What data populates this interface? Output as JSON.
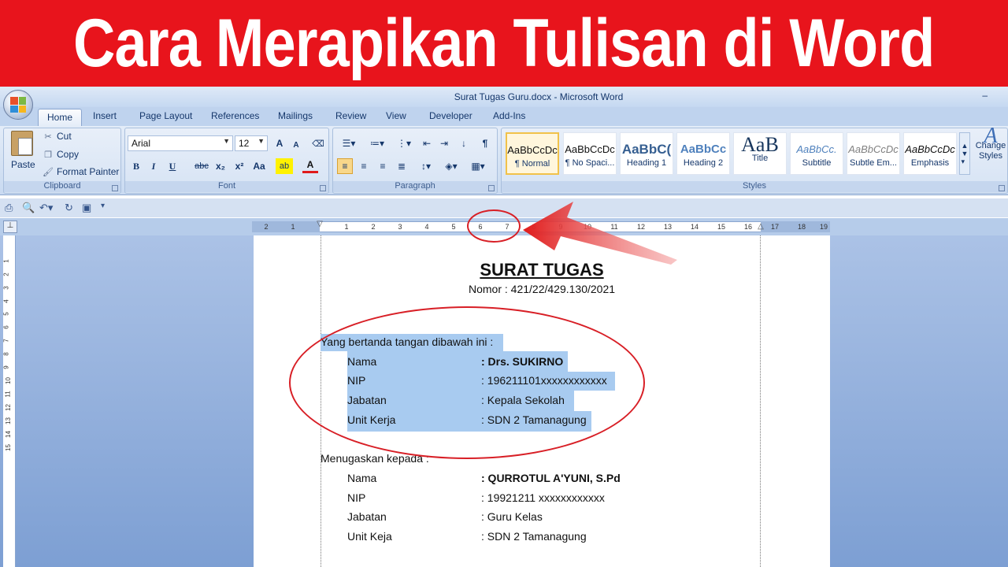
{
  "banner": {
    "title": "Cara Merapikan Tulisan di Word"
  },
  "window": {
    "title": "Surat Tugas Guru.docx - Microsoft Word",
    "minimize": "–"
  },
  "tabs": [
    "Home",
    "Insert",
    "Page Layout",
    "References",
    "Mailings",
    "Review",
    "View",
    "Developer",
    "Add-Ins"
  ],
  "clipboard": {
    "paste": "Paste",
    "cut": "Cut",
    "copy": "Copy",
    "format_painter": "Format Painter",
    "label": "Clipboard"
  },
  "font": {
    "name": "Arial",
    "size": "12",
    "label": "Font",
    "grow": "A",
    "shrink": "A",
    "bold": "B",
    "italic": "I",
    "underline": "U",
    "strike": "abc",
    "sub": "x₂",
    "sup": "x²",
    "case": "Aa"
  },
  "paragraph": {
    "label": "Paragraph",
    "pilcrow": "¶"
  },
  "styles": {
    "label": "Styles",
    "items": [
      {
        "sample": "AaBbCcDc",
        "name": "¶ Normal"
      },
      {
        "sample": "AaBbCcDc",
        "name": "¶ No Spaci..."
      },
      {
        "sample": "AaBbC(",
        "name": "Heading 1"
      },
      {
        "sample": "AaBbCc",
        "name": "Heading 2"
      },
      {
        "sample": "AaB",
        "name": "Title"
      },
      {
        "sample": "AaBbCc.",
        "name": "Subtitle"
      },
      {
        "sample": "AaBbCcDc",
        "name": "Subtle Em..."
      },
      {
        "sample": "AaBbCcDc",
        "name": "Emphasis"
      }
    ],
    "change_styles": "Change Styles"
  },
  "ruler": {
    "ticks": [
      "2",
      "1",
      "1",
      "2",
      "3",
      "4",
      "5",
      "6",
      "7",
      "8",
      "9",
      "10",
      "11",
      "12",
      "13",
      "14",
      "15",
      "16",
      "17",
      "18",
      "19"
    ]
  },
  "vruler": {
    "ticks": [
      "1",
      "2",
      "3",
      "4",
      "5",
      "6",
      "7",
      "8",
      "9",
      "10",
      "11",
      "12",
      "13",
      "14",
      "15"
    ]
  },
  "document": {
    "title": "SURAT TUGAS",
    "number": "Nomor : 421/22/429.130/2021",
    "intro": "Yang bertanda tangan dibawah ini :",
    "signer": [
      {
        "label": "Nama",
        "value": ": Drs.  SUKIRNO"
      },
      {
        "label": "NIP",
        "value": ": 196211101xxxxxxxxxxxx"
      },
      {
        "label": "Jabatan",
        "value": ": Kepala  Sekolah"
      },
      {
        "label": "Unit Kerja",
        "value": ": SDN 2 Tamanagung"
      }
    ],
    "assign": "Menugaskan kepada :",
    "assignee": [
      {
        "label": "Nama",
        "value": ":  QURROTUL A'YUNI,  S.Pd"
      },
      {
        "label": "NIP",
        "value": ": 19921211 xxxxxxxxxxxx"
      },
      {
        "label": "Jabatan",
        "value": ": Guru Kelas"
      },
      {
        "label": "Unit Keja",
        "value": ": SDN 2 Tamanagung"
      }
    ]
  }
}
